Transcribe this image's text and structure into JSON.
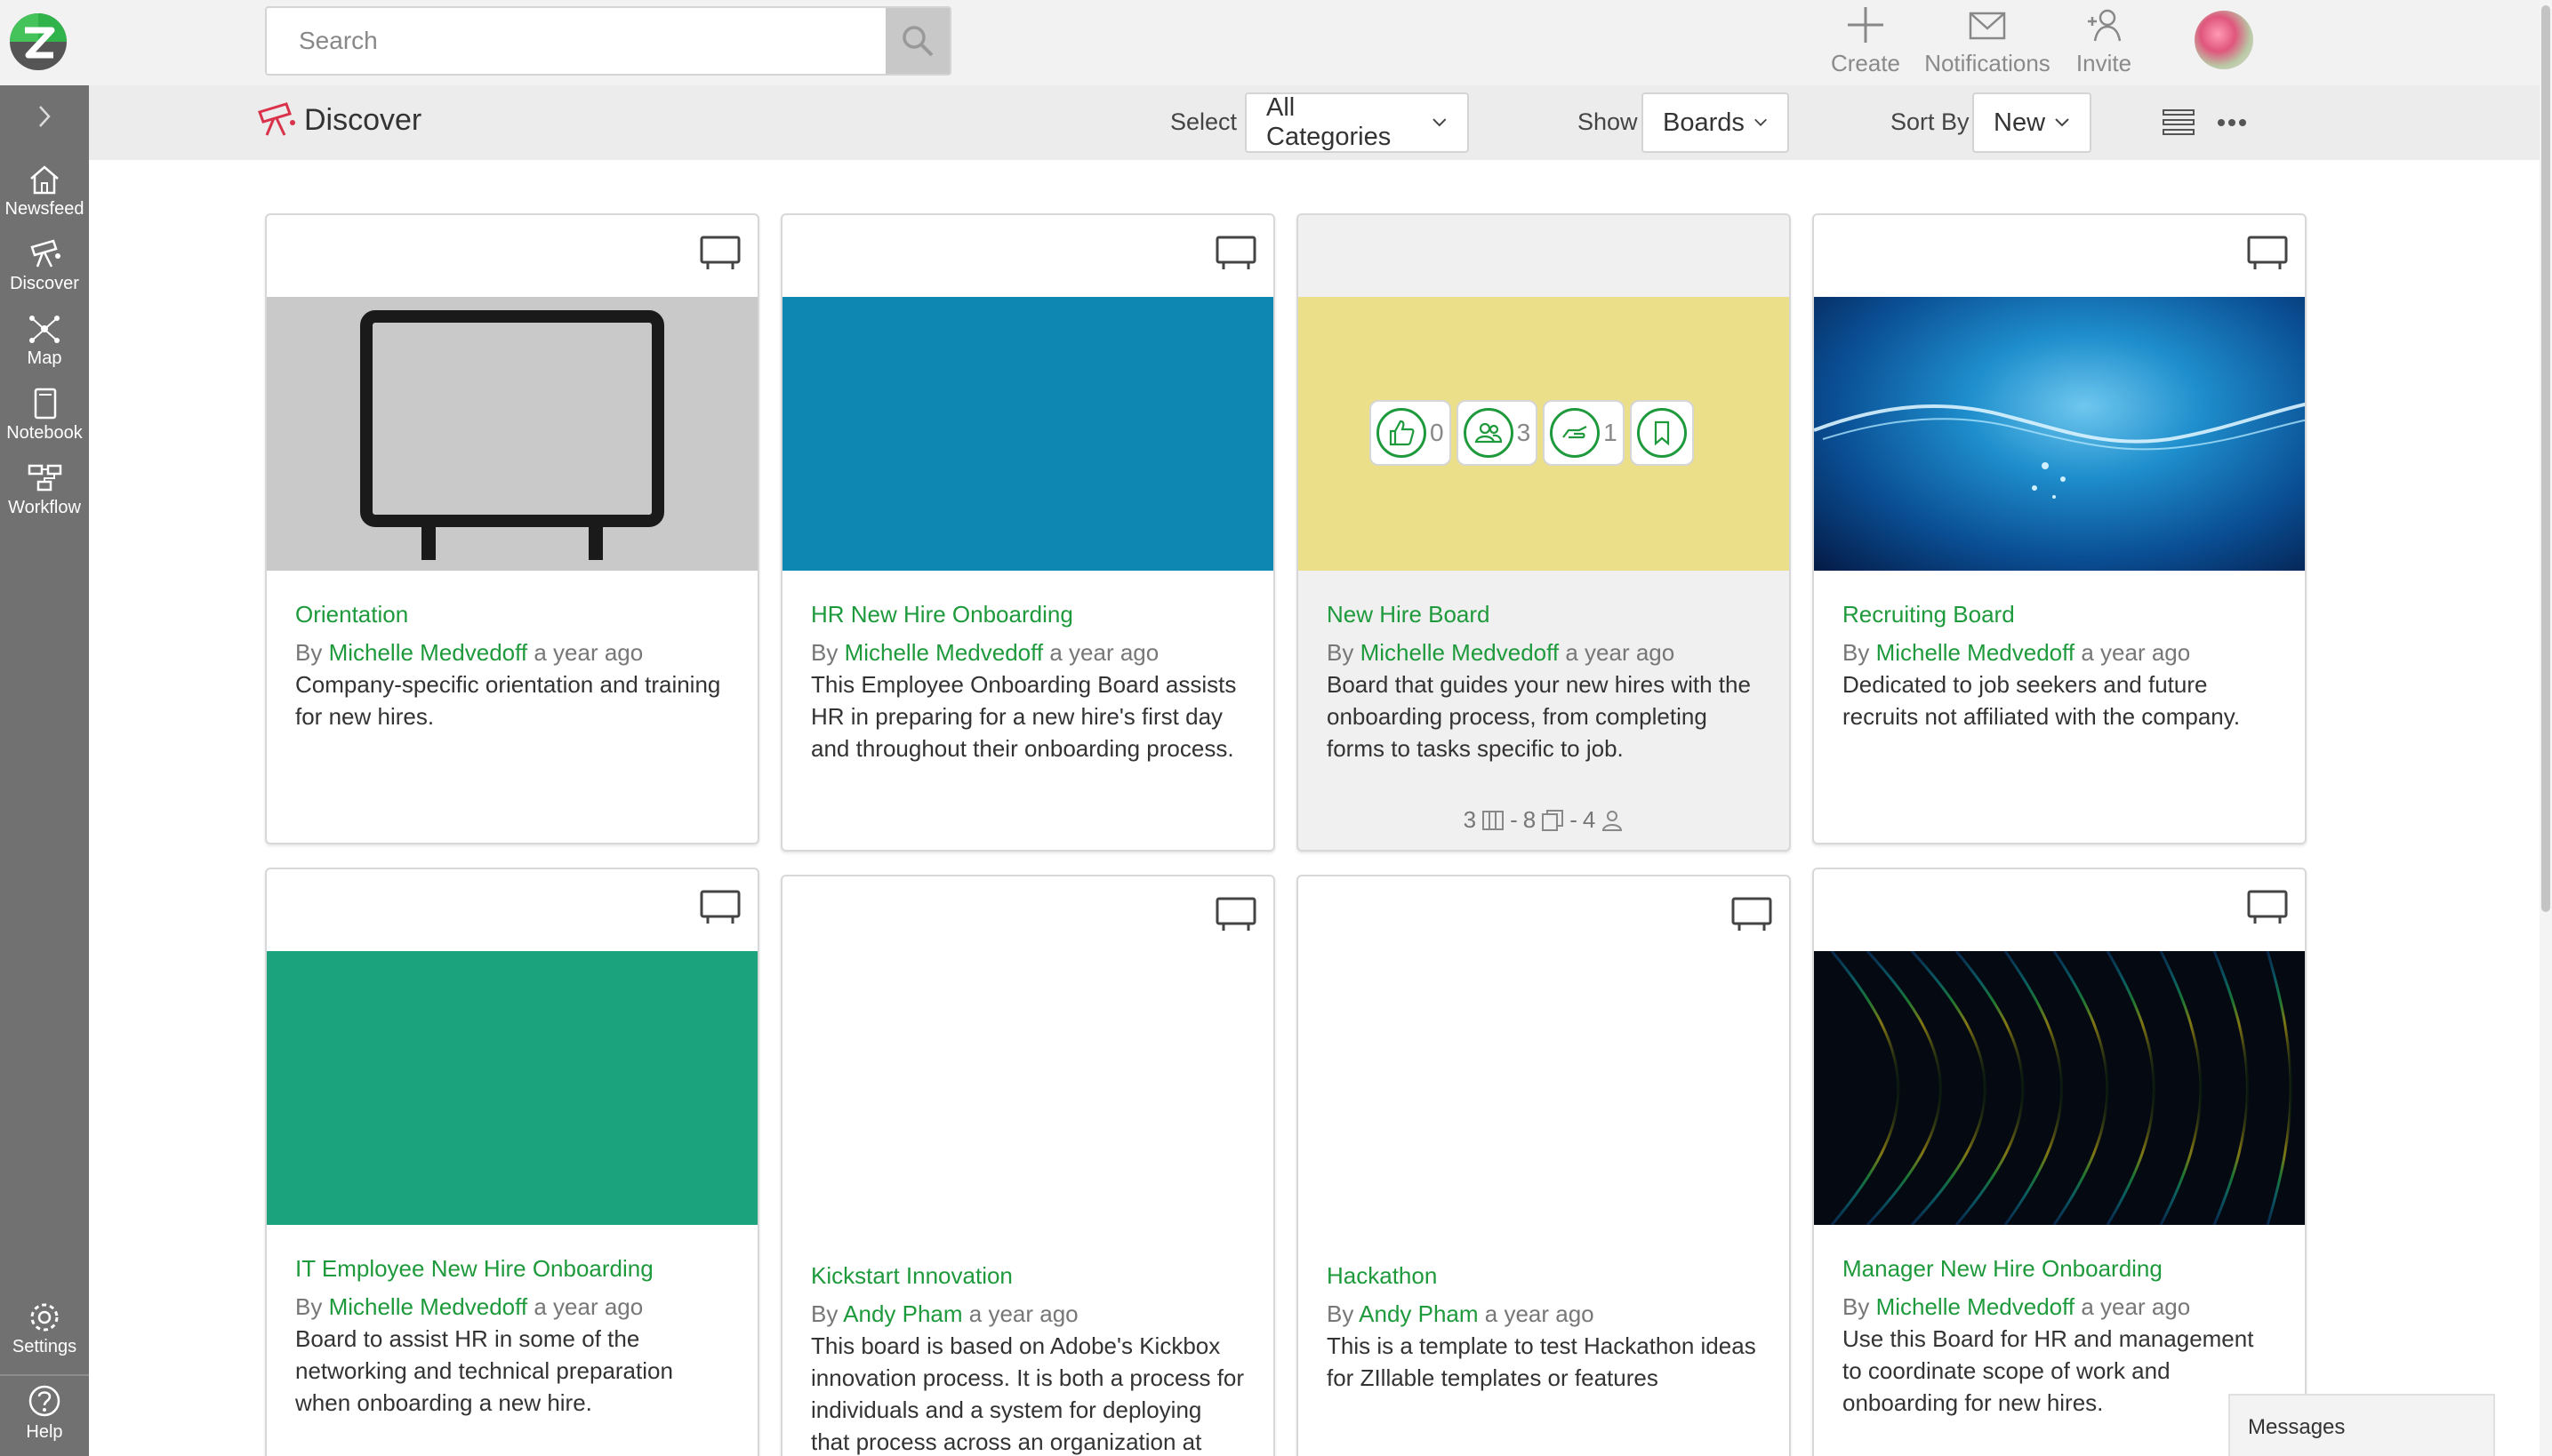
{
  "header": {
    "search_placeholder": "Search",
    "actions": [
      {
        "label": "Create",
        "icon": "plus-icon"
      },
      {
        "label": "Notifications",
        "icon": "envelope-icon"
      },
      {
        "label": "Invite",
        "icon": "add-person-icon"
      }
    ]
  },
  "sidebar": {
    "items": [
      {
        "label": "Newsfeed",
        "icon": "home-icon"
      },
      {
        "label": "Discover",
        "icon": "telescope-icon"
      },
      {
        "label": "Map",
        "icon": "network-icon"
      },
      {
        "label": "Notebook",
        "icon": "notebook-icon"
      },
      {
        "label": "Workflow",
        "icon": "workflow-icon"
      }
    ],
    "bottom_items": [
      {
        "label": "Settings",
        "icon": "gear-icon"
      },
      {
        "label": "Help",
        "icon": "question-icon"
      }
    ]
  },
  "page": {
    "title": "Discover",
    "select_label": "Select",
    "select_value": "All Categories",
    "show_label": "Show",
    "show_value": "Boards",
    "sort_label": "Sort By",
    "sort_value": "New"
  },
  "cards": [
    {
      "title": "Orientation",
      "by": "By",
      "author": "Michelle Medvedoff",
      "time": "a year ago",
      "desc": "Company-specific orientation and training for new hires.",
      "image": "whiteboard-placeholder"
    },
    {
      "title": "HR New Hire Onboarding",
      "by": "By",
      "author": "Michelle Medvedoff",
      "time": "a year ago",
      "desc": "This Employee Onboarding Board assists HR in preparing for a new hire's first day and throughout their onboarding process.",
      "image_color": "#0e87b3"
    },
    {
      "title": "New Hire Board",
      "by": "By",
      "author": "Michelle Medvedoff",
      "time": "a year ago",
      "desc": "Board that guides your new hires with the onboarding process, from completing forms to tasks specific to job.",
      "image_color": "#ecdf8a",
      "reactions": {
        "likes": "0",
        "members": "3",
        "shares": "1"
      },
      "stats": {
        "columns": "3",
        "cards": "8",
        "people": "4",
        "sep": "-"
      }
    },
    {
      "title": "Recruiting Board",
      "by": "By",
      "author": "Michelle Medvedoff",
      "time": "a year ago",
      "desc": "Dedicated to job seekers and future recruits not affiliated with the company.",
      "image": "water-splash"
    },
    {
      "title": "IT Employee New Hire Onboarding",
      "by": "By",
      "author": "Michelle Medvedoff",
      "time": "a year ago",
      "desc": "Board to assist HR in some of the networking and technical preparation when onboarding a new hire.",
      "image_color": "#1ba37e"
    },
    {
      "title": "Kickstart Innovation",
      "by": "By",
      "author": "Andy Pham",
      "time": "a year ago",
      "desc": "This board is based on Adobe's Kickbox innovation process. It is both a process for individuals and a system for deploying that process across an organization at"
    },
    {
      "title": "Hackathon",
      "by": "By",
      "author": "Andy Pham",
      "time": "a year ago",
      "desc": "This is a template to test Hackathon ideas for ZIllable templates or features"
    },
    {
      "title": "Manager New Hire Onboarding",
      "by": "By",
      "author": "Michelle Medvedoff",
      "time": "a year ago",
      "desc": "Use this Board for HR and management to coordinate scope of work and onboarding for new hires.",
      "image": "dark-spectrum"
    }
  ],
  "messages_label": "Messages",
  "colors": {
    "accent": "#1e9a3c",
    "sidebar": "#717171"
  }
}
